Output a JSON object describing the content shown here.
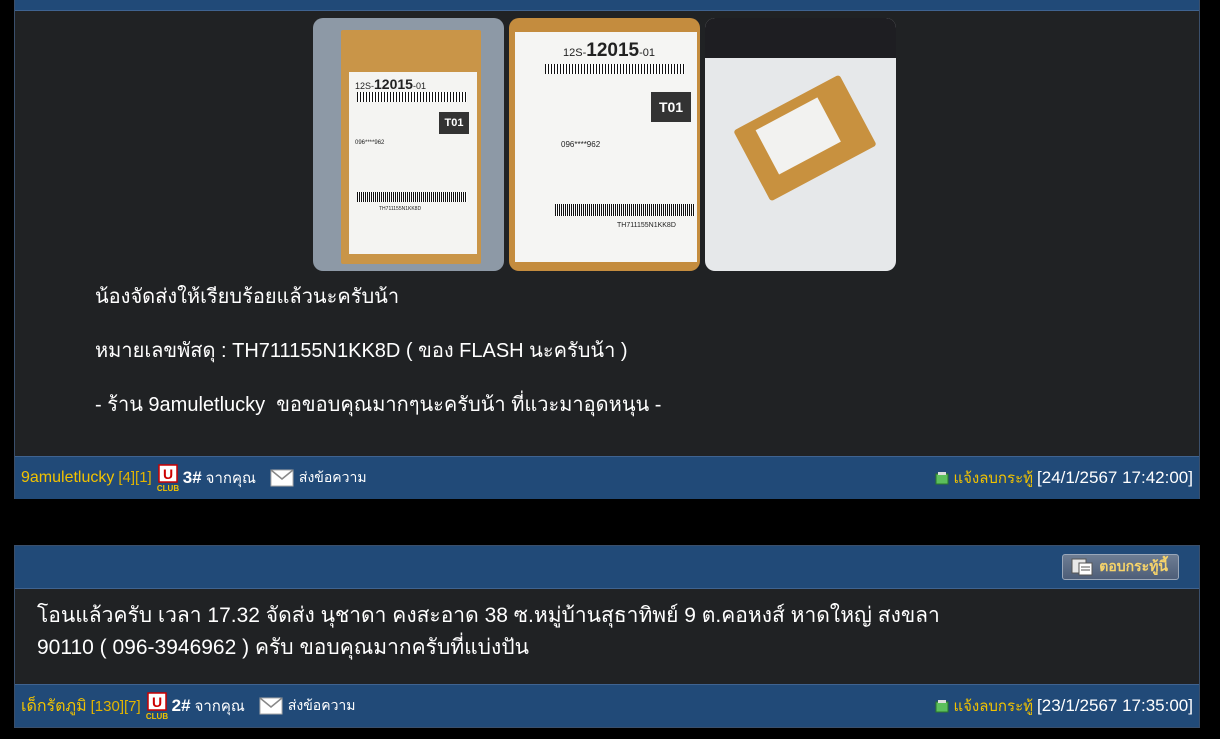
{
  "post1": {
    "lines": [
      "น้องจัดส่งให้เรียบร้อยแล้วนะครับน้า",
      "หมายเลขพัสดุ : TH711155N1KK8D ( ของ FLASH นะครับน้า )",
      "- ร้าน 9amuletlucky  ขอขอบคุณมากๆนะครับน้า ที่แวะมาอุดหนุน -"
    ],
    "photo_labels": {
      "code_prefix": "12S-",
      "code": "12015",
      "code_suffix": "-01",
      "tag": "T01",
      "tracking": "TH711155N1KK8D",
      "phone": "096****962"
    },
    "footer": {
      "username": "9amuletlucky",
      "stats": "[4][1]",
      "club_label": "CLUB",
      "club_letter": "U",
      "count": "3#",
      "from": "จากคุณ",
      "send_message": "ส่งข้อความ",
      "report": "แจ้งลบกระทู้",
      "timestamp": "[24/1/2567 17:42:00]"
    }
  },
  "post2": {
    "reply_label": "ตอบกระทู้นี้",
    "message": "โอนแล้วครับ เวลา 17.32 จัดส่ง นุชาดา คงสะอาด 38 ซ.หมู่บ้านสุธาทิพย์ 9 ต.คอหงส์ หาดใหญ่ สงขลา 90110 ( 096-3946962 ) ครับ ขอบคุณมากครับที่แบ่งปัน",
    "footer": {
      "username": "เด็กรัตภูมิ",
      "stats": "[130][7]",
      "club_label": "CLUB",
      "club_letter": "U",
      "count": "2#",
      "from": "จากคุณ",
      "send_message": "ส่งข้อความ",
      "report": "แจ้งลบกระทู้",
      "timestamp": "[23/1/2567 17:35:00]"
    }
  }
}
